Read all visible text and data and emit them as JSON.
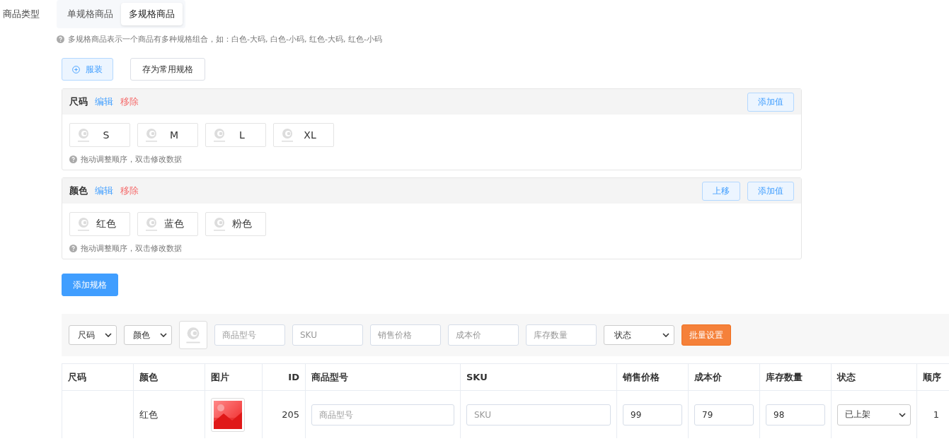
{
  "field_label": "商品类型",
  "type_tabs": [
    {
      "label": "单规格商品",
      "selected": false
    },
    {
      "label": "多规格商品",
      "selected": true
    }
  ],
  "type_hint": "多规格商品表示一个商品有多种规格组合，如：白色-大码, 白色-小码, 红色-大码, 红色-小码",
  "template_button": "服装",
  "save_button": "存为常用规格",
  "specs": [
    {
      "name": "尺码",
      "edit": "编辑",
      "remove": "移除",
      "buttons": [
        "添加值"
      ],
      "values": [
        "S",
        "M",
        "L",
        "XL"
      ],
      "hint": "拖动调整顺序，双击修改数据"
    },
    {
      "name": "颜色",
      "edit": "编辑",
      "remove": "移除",
      "buttons": [
        "上移",
        "添加值"
      ],
      "values": [
        "红色",
        "蓝色",
        "粉色"
      ],
      "hint": "拖动调整顺序，双击修改数据"
    }
  ],
  "add_spec_button": "添加规格",
  "batch": {
    "selects": [
      "尺码",
      "颜色"
    ],
    "input_placeholders": [
      "商品型号",
      "SKU",
      "销售价格",
      "成本价",
      "库存数量"
    ],
    "status_select": "状态",
    "apply_button": "批量设置"
  },
  "table": {
    "columns": [
      "尺码",
      "颜色",
      "图片",
      "ID",
      "商品型号",
      "SKU",
      "销售价格",
      "成本价",
      "库存数量",
      "状态",
      "顺序"
    ],
    "rows": [
      {
        "colour_value": "红色",
        "id": "205",
        "model_placeholder": "商品型号",
        "sku_placeholder": "SKU",
        "price": "99",
        "cost": "79",
        "stock": "98",
        "status": "已上架",
        "order": "1"
      }
    ]
  }
}
